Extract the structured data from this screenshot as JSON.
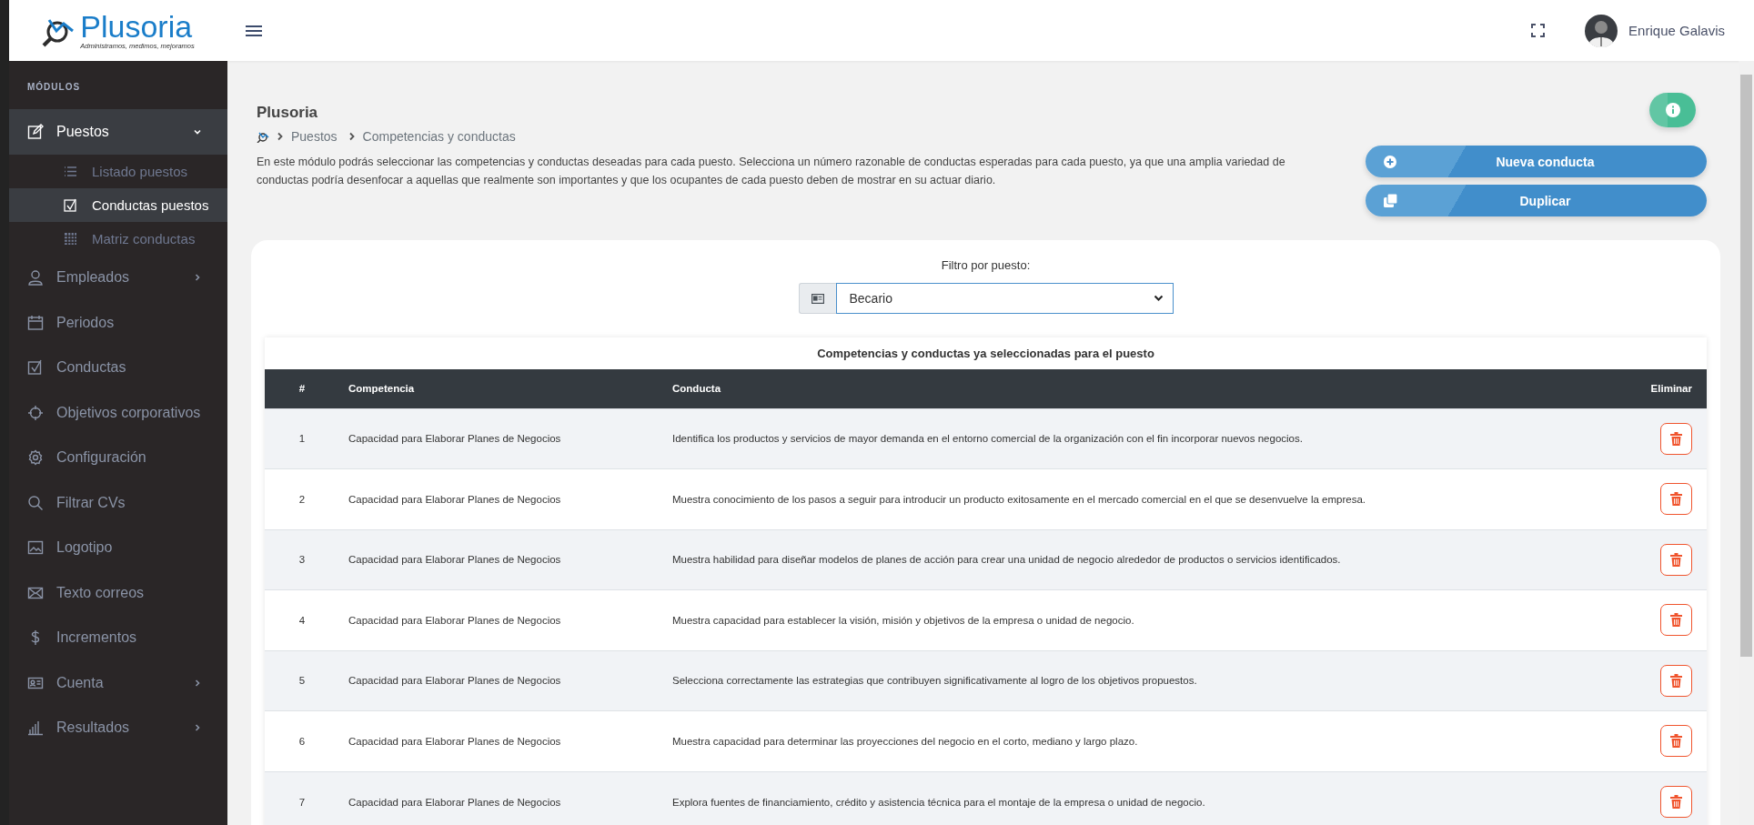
{
  "header": {
    "logo_text": "Plusoria",
    "logo_tagline": "Administramos, medimos, mejoramos",
    "user_name": "Enrique Galavis"
  },
  "sidebar": {
    "section_label": "MÓDULOS",
    "items": [
      {
        "kind": "group",
        "label": "Puestos",
        "selected": true,
        "expanded": true,
        "children": [
          {
            "label": "Listado puestos",
            "selected": false
          },
          {
            "label": "Conductas puestos",
            "selected": true
          },
          {
            "label": "Matriz conductas",
            "selected": false
          }
        ]
      },
      {
        "kind": "group",
        "label": "Empleados",
        "selected": false,
        "expanded": false
      },
      {
        "kind": "link",
        "label": "Periodos",
        "selected": false
      },
      {
        "kind": "link",
        "label": "Conductas",
        "selected": false
      },
      {
        "kind": "link",
        "label": "Objetivos corporativos",
        "selected": false
      },
      {
        "kind": "link",
        "label": "Configuración",
        "selected": false
      },
      {
        "kind": "link",
        "label": "Filtrar CVs",
        "selected": false
      },
      {
        "kind": "link",
        "label": "Logotipo",
        "selected": false
      },
      {
        "kind": "link",
        "label": "Texto correos",
        "selected": false
      },
      {
        "kind": "link",
        "label": "Incrementos",
        "selected": false
      },
      {
        "kind": "group",
        "label": "Cuenta",
        "selected": false,
        "expanded": false
      },
      {
        "kind": "group",
        "label": "Resultados",
        "selected": false,
        "expanded": false
      }
    ]
  },
  "page": {
    "title": "Plusoria",
    "breadcrumb": [
      "Puestos",
      "Competencias y conductas"
    ],
    "description": "En este módulo podrás seleccionar las competencias y conductas deseadas para cada puesto. Selecciona un número razonable de conductas esperadas para cada puesto, ya que una amplia variedad de conductas podría desenfocar a aquellas que realmente son importantes y que los ocupantes de cada puesto deben de mostrar en su actuar diario.",
    "buttons": [
      {
        "kind": "add",
        "label": "Nueva conducta"
      },
      {
        "kind": "duplicate",
        "label": "Duplicar"
      }
    ]
  },
  "filter": {
    "label": "Filtro por puesto:",
    "value": "Becario"
  },
  "table": {
    "title": "Competencias y conductas ya seleccionadas para el puesto",
    "columns": [
      "#",
      "Competencia",
      "Conducta",
      "Eliminar"
    ],
    "rows": [
      {
        "number": "1",
        "competencia": "Capacidad para Elaborar Planes de Negocios",
        "conducta": "Identifica los productos y servicios de mayor demanda en el entorno comercial de la organización con el fin incorporar nuevos negocios."
      },
      {
        "number": "2",
        "competencia": "Capacidad para Elaborar Planes de Negocios",
        "conducta": "Muestra conocimiento de los pasos a seguir para introducir un producto exitosamente en el mercado comercial en el que se desenvuelve la empresa."
      },
      {
        "number": "3",
        "competencia": "Capacidad para Elaborar Planes de Negocios",
        "conducta": "Muestra habilidad para diseñar modelos de planes de acción para crear una unidad de negocio alrededor de productos o servicios identificados."
      },
      {
        "number": "4",
        "competencia": "Capacidad para Elaborar Planes de Negocios",
        "conducta": "Muestra capacidad para establecer la visión, misión y objetivos de la empresa o unidad de negocio."
      },
      {
        "number": "5",
        "competencia": "Capacidad para Elaborar Planes de Negocios",
        "conducta": "Selecciona correctamente las estrategias que contribuyen significativamente al logro de los objetivos propuestos."
      },
      {
        "number": "6",
        "competencia": "Capacidad para Elaborar Planes de Negocios",
        "conducta": "Muestra capacidad para determinar las proyecciones del negocio en el corto, mediano y largo plazo."
      },
      {
        "number": "7",
        "competencia": "Capacidad para Elaborar Planes de Negocios",
        "conducta": "Explora fuentes de financiamiento, crédito y asistencia técnica para el montaje de la empresa o unidad de negocio."
      }
    ]
  }
}
